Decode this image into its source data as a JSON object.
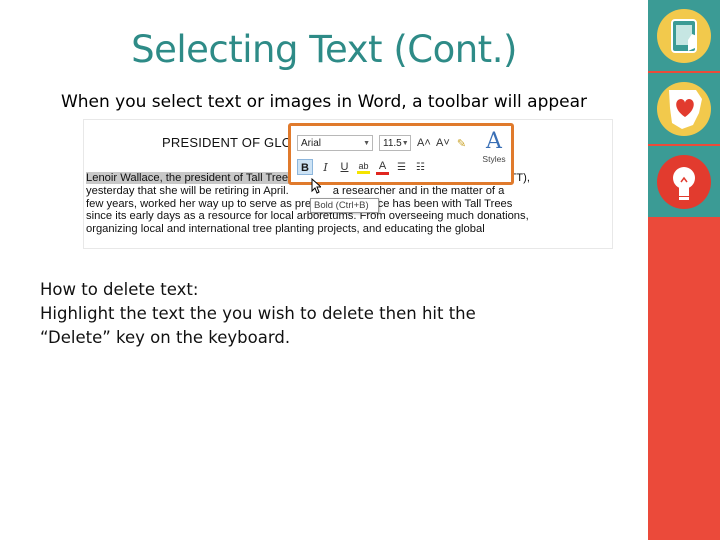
{
  "slide": {
    "title": "Selecting Text (Cont.)",
    "subtitle": "When you select text or images in Word, a toolbar will appear",
    "body_lines": [
      "How to delete text:",
      "Highlight the text the you wish to delete then hit the",
      "“Delete” key on the keyboard."
    ]
  },
  "screenshot": {
    "heading": "PRESIDENT OF GLOBAL",
    "paragraph": [
      "Lenoir Wallace, the president of Tall Trees",
      "yesterday that she will be retiring in April.",
      "few years, worked her way up to serve as president.",
      "since its early days as a resource for local arboretums. From overseeing much donations,",
      "organizing local and international tree planting projects, and educating the global"
    ],
    "paragraph_right": [
      "(TT),",
      "a researcher and in the matter of a",
      "Wallace has been with Tall Trees"
    ],
    "toolbar": {
      "font_value": "Arial",
      "size_value": "11.5",
      "grow_font": "A˄",
      "shrink_font": "A˅",
      "bold": "B",
      "italic": "I",
      "underline": "U",
      "highlight": "ab",
      "font_color": "A",
      "styles_label": "Styles"
    },
    "tooltip": "Bold (Ctrl+B)"
  },
  "colors": {
    "title": "#2e8b87",
    "sidebar": "#eb4a3a",
    "toolbar_border": "#e07a2c"
  },
  "sidebar_icons": [
    "tablet-touch-icon",
    "ohio-heart-icon",
    "lightbulb-icon"
  ]
}
